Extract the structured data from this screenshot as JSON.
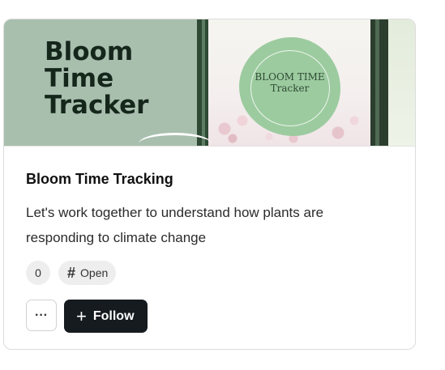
{
  "card": {
    "banner": {
      "title_lines": [
        "Bloom",
        "Time",
        "Tracker"
      ],
      "logo_text_line1": "BLOOM TIME",
      "logo_text_line2": "Tracker"
    },
    "title": "Bloom Time Tracking",
    "description": "Let's work together to understand how plants are responding to climate change",
    "tags": {
      "count": "0",
      "status_icon": "hash-icon",
      "status_symbol": "#",
      "status_label": "Open"
    },
    "actions": {
      "more_icon": "more-horizontal-icon",
      "more_label": "···",
      "follow_icon": "plus-icon",
      "follow_symbol": "+",
      "follow_label": "Follow"
    }
  },
  "colors": {
    "banner_green": "#a9bfae",
    "blob_green": "#9ccb9f",
    "button_dark": "#151b1f",
    "tag_bg": "#eeeeee"
  }
}
